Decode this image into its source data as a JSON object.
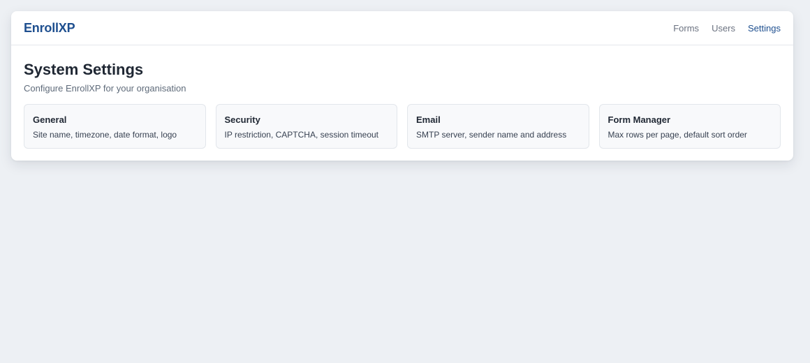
{
  "header": {
    "brand": "EnrollXP",
    "nav": [
      {
        "label": "Forms"
      },
      {
        "label": "Users"
      },
      {
        "label": "Settings",
        "active": true
      }
    ]
  },
  "main": {
    "title": "System Settings",
    "subtitle": "Configure EnrollXP for your organisation",
    "tiles": [
      {
        "title": "General",
        "description": "Site name, timezone, date format, logo"
      },
      {
        "title": "Security",
        "description": "IP restriction, CAPTCHA, session timeout"
      },
      {
        "title": "Email",
        "description": "SMTP server, sender name and address"
      },
      {
        "title": "Form Manager",
        "description": "Max rows per page, default sort order"
      }
    ]
  },
  "colors": {
    "background": "#edf0f4",
    "accent": "#1e4f8f",
    "muted_text": "#6b7280"
  }
}
